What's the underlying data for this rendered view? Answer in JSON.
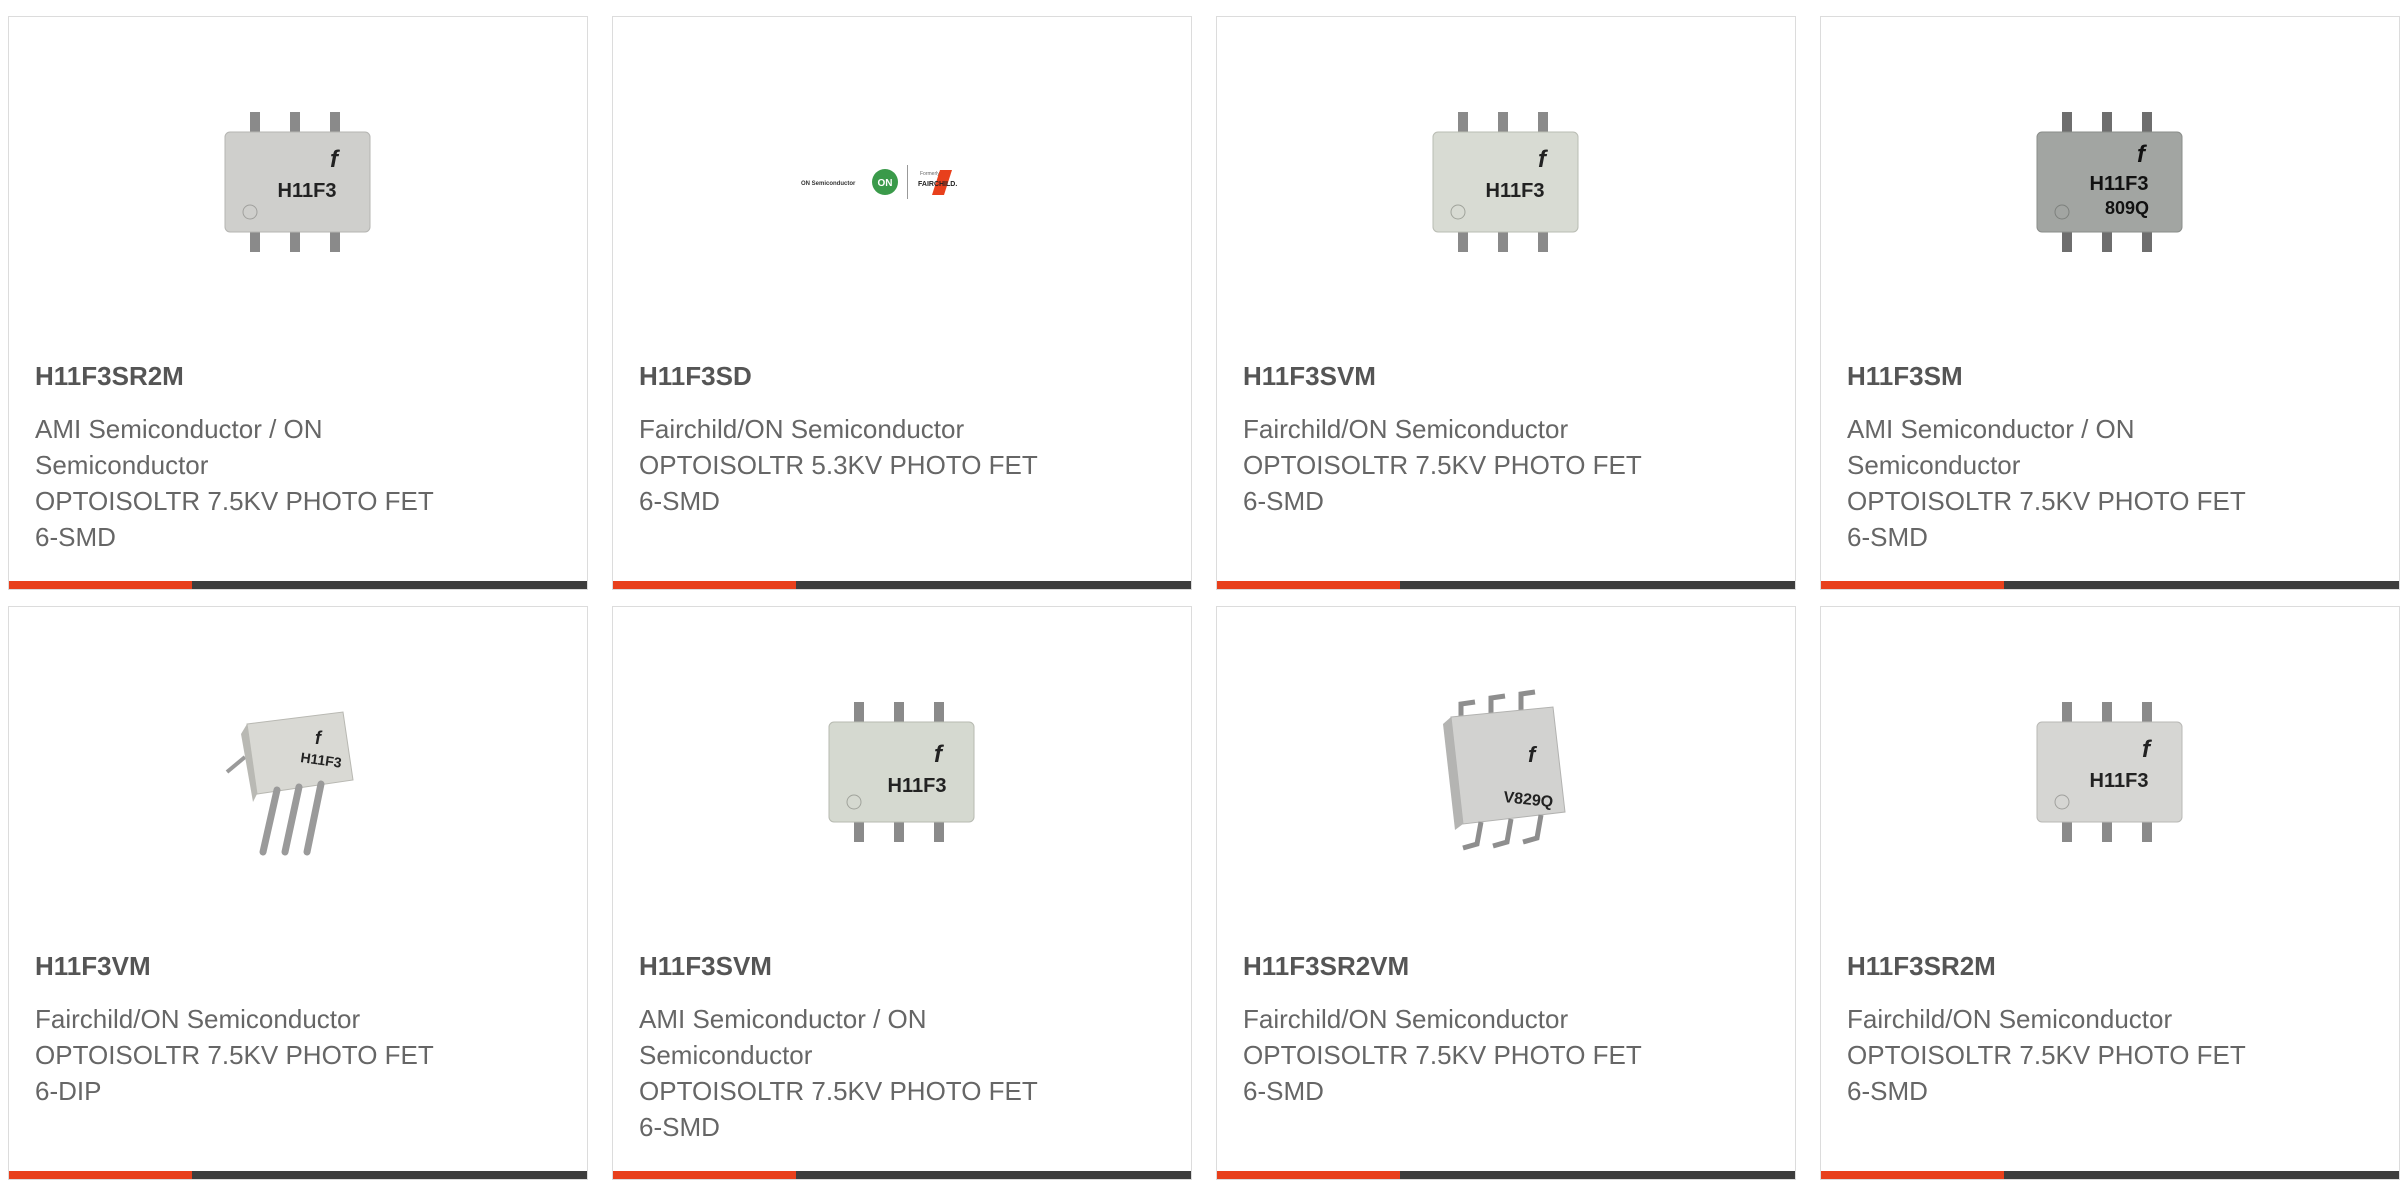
{
  "products": [
    {
      "part": "H11F3SR2M",
      "manufacturer": "AMI Semiconductor / ON Semiconductor",
      "description": "OPTOISOLTR 7.5KV PHOTO FET 6-SMD",
      "image": "chip-smd-icon",
      "marking": [
        "H11F3"
      ]
    },
    {
      "part": "H11F3SD",
      "manufacturer": "Fairchild/ON Semiconductor",
      "description": "OPTOISOLTR 5.3KV PHOTO FET 6-SMD",
      "image": "on-fairchild-logo",
      "logo_text": [
        "ON Semiconductor",
        "ON",
        "Formerly",
        "FAIRCHILD."
      ]
    },
    {
      "part": "H11F3SVM",
      "manufacturer": "Fairchild/ON Semiconductor",
      "description": "OPTOISOLTR 7.5KV PHOTO FET 6-SMD",
      "image": "chip-smd-icon",
      "marking": [
        "H11F3"
      ]
    },
    {
      "part": "H11F3SM",
      "manufacturer": "AMI Semiconductor / ON Semiconductor",
      "description": "OPTOISOLTR 7.5KV PHOTO FET 6-SMD",
      "image": "chip-smd-dark-icon",
      "marking": [
        "H11F3",
        "809Q"
      ]
    },
    {
      "part": "H11F3VM",
      "manufacturer": "Fairchild/ON Semiconductor",
      "description": "OPTOISOLTR 7.5KV PHOTO FET 6-DIP",
      "image": "chip-dip-angled-icon",
      "marking": [
        "H11F3"
      ]
    },
    {
      "part": "H11F3SVM",
      "manufacturer": "AMI Semiconductor / ON Semiconductor",
      "description": "OPTOISOLTR 7.5KV PHOTO FET 6-SMD",
      "image": "chip-smd-icon",
      "marking": [
        "H11F3"
      ]
    },
    {
      "part": "H11F3SR2VM",
      "manufacturer": "Fairchild/ON Semiconductor",
      "description": "OPTOISOLTR 7.5KV PHOTO FET 6-SMD",
      "image": "chip-smd-angled-icon",
      "marking": [
        "V829Q"
      ]
    },
    {
      "part": "H11F3SR2M",
      "manufacturer": "Fairchild/ON Semiconductor",
      "description": "OPTOISOLTR 7.5KV PHOTO FET 6-SMD",
      "image": "chip-smd-icon",
      "marking": [
        "H11F3"
      ]
    }
  ],
  "colors": {
    "accent": "#e8401c",
    "bar": "#3d3d3d",
    "border": "#dcdcdc"
  }
}
